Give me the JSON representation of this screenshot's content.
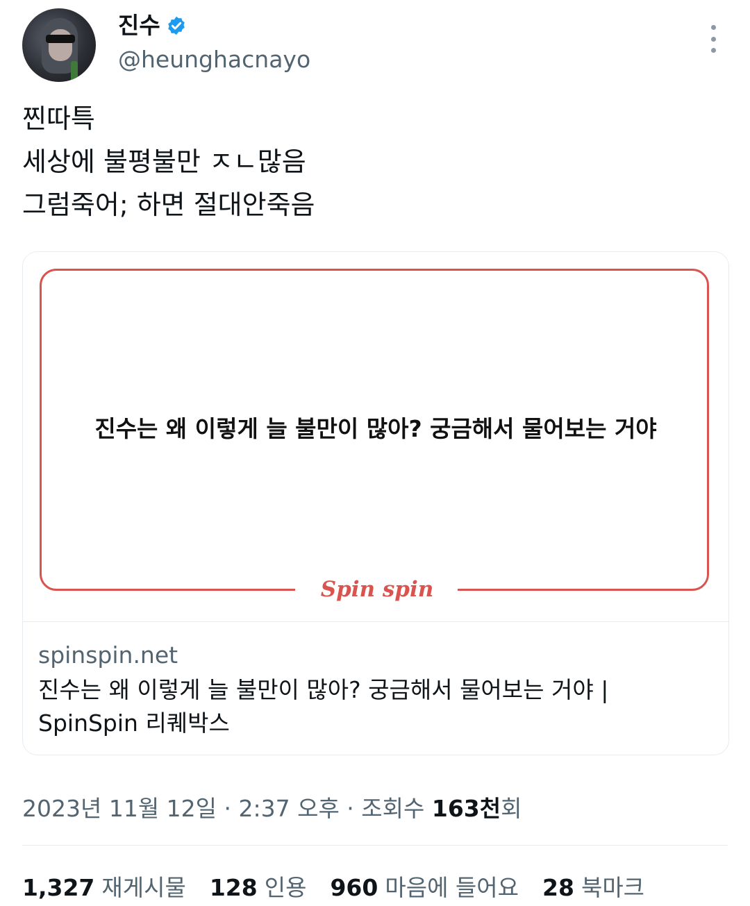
{
  "author": {
    "name": "진수",
    "handle": "@heunghacnayo"
  },
  "tweet": {
    "lines": [
      "찐따특",
      "세상에 불평불만 ㅈㄴ많음",
      "그럼죽어; 하면 절대안죽음"
    ]
  },
  "card": {
    "image_text": "진수는 왜 이렇게 늘 불만이 많아? 궁금해서 물어보는 거야",
    "logo_text": "Spin spin",
    "domain": "spinspin.net",
    "title": "진수는 왜 이렇게 늘 불만이 많아? 궁금해서 물어보는 거야 | SpinSpin 리퀘박스",
    "accent_color": "#d9534f"
  },
  "meta": {
    "datetime": "2023년 11월 12일 · 2:37 오후 · 조회수 ",
    "views": "163천",
    "views_suffix": "회"
  },
  "stats": [
    {
      "count": "1,327",
      "label": "재게시물"
    },
    {
      "count": "128",
      "label": "인용"
    },
    {
      "count": "960",
      "label": "마음에 들어요"
    },
    {
      "count": "28",
      "label": "북마크"
    }
  ],
  "icons": {
    "verified": "verified-badge-icon",
    "more": "more-icon"
  }
}
